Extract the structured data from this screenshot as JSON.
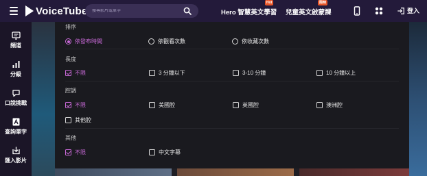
{
  "header": {
    "brand": "VoiceTube",
    "search_placeholder": "搜尋影片或單字",
    "nav": [
      {
        "label": "Hero 智慧英文學習",
        "badge": "Hot"
      },
      {
        "label": "兒童英文啟蒙課",
        "badge": "限時"
      }
    ],
    "login_label": "登入",
    "icons": [
      "menu-icon",
      "search-icon",
      "phone-icon",
      "apps-icon",
      "login-icon"
    ]
  },
  "sidebar": {
    "items": [
      {
        "label": "頻道",
        "icon": "channel-icon"
      },
      {
        "label": "分級",
        "icon": "level-icon"
      },
      {
        "label": "口說挑戰",
        "icon": "speech-icon"
      },
      {
        "label": "查詢單字",
        "icon": "dictionary-icon"
      },
      {
        "label": "匯入影片",
        "icon": "import-icon"
      }
    ]
  },
  "filters": {
    "sort": {
      "title": "排序",
      "options": [
        {
          "label": "依發布時間",
          "selected": true
        },
        {
          "label": "依觀看次數",
          "selected": false
        },
        {
          "label": "依收藏次數",
          "selected": false
        }
      ]
    },
    "length": {
      "title": "長度",
      "options": [
        {
          "label": "不限",
          "checked": true
        },
        {
          "label": "3 分鐘以下",
          "checked": false
        },
        {
          "label": "3-10 分鐘",
          "checked": false
        },
        {
          "label": "10 分鐘以上",
          "checked": false
        }
      ]
    },
    "accent": {
      "title": "腔調",
      "options": [
        {
          "label": "不限",
          "checked": true
        },
        {
          "label": "美國腔",
          "checked": false
        },
        {
          "label": "英國腔",
          "checked": false
        },
        {
          "label": "澳洲腔",
          "checked": false
        },
        {
          "label": "其他腔",
          "checked": false
        }
      ]
    },
    "other": {
      "title": "其他",
      "options": [
        {
          "label": "不限",
          "checked": true
        },
        {
          "label": "中文字幕",
          "checked": false
        }
      ]
    }
  },
  "colors": {
    "header_bg": "#231a3a",
    "accent": "#c96ad8",
    "badge": "#e8572a",
    "panel_bg": "#1a1a1f"
  }
}
